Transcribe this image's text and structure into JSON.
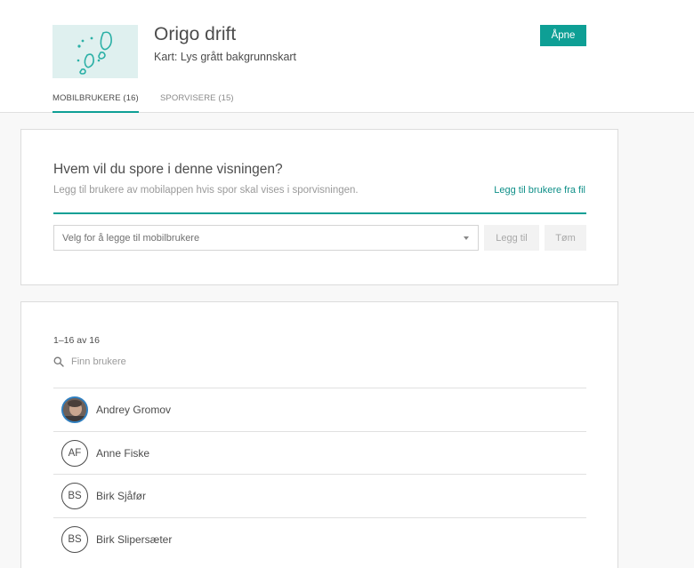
{
  "header": {
    "title": "Origo drift",
    "subtitle": "Kart: Lys grått bakgrunnskart",
    "open_label": "Åpne",
    "thumbnail_icon": "footprints-icon"
  },
  "tabs": [
    {
      "label": "MOBILBRUKERE (16)",
      "active": true
    },
    {
      "label": "SPORVISERE (15)",
      "active": false
    }
  ],
  "add_panel": {
    "question": "Hvem vil du spore i denne visningen?",
    "description": "Legg til brukere av mobilappen hvis spor skal vises i sporvisningen.",
    "file_link": "Legg til brukere fra fil",
    "select_placeholder": "Velg for å legge til mobilbrukere",
    "add_label": "Legg til",
    "clear_label": "Tøm"
  },
  "user_panel": {
    "count": "1–16 av 16",
    "search_placeholder": "Finn brukere",
    "users": [
      {
        "initials": "",
        "name": "Andrey Gromov",
        "has_photo": true
      },
      {
        "initials": "AF",
        "name": "Anne Fiske",
        "has_photo": false
      },
      {
        "initials": "BS",
        "name": "Birk Sjåfør",
        "has_photo": false
      },
      {
        "initials": "BS",
        "name": "Birk Slipersæter",
        "has_photo": false
      }
    ]
  },
  "colors": {
    "accent": "#0e9f95",
    "thumbnail_bg": "#dff0ef",
    "page_bg": "#f8f8f8"
  }
}
